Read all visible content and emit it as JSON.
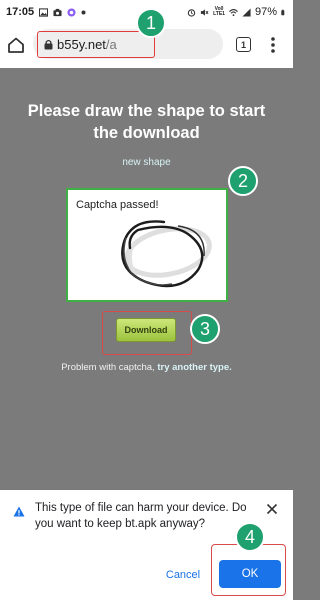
{
  "status_bar": {
    "time": "17:05",
    "network": [
      "Vo0",
      "LTE1",
      "LTE"
    ],
    "battery": "97%"
  },
  "address_bar": {
    "host": "b55y.net",
    "path": "/a",
    "tab_count": "1"
  },
  "page": {
    "title": "Please draw the shape to start the download",
    "new_shape": "new shape",
    "captcha_status": "Captcha passed!",
    "download_label": "Download",
    "problem_text": "Problem with captcha,",
    "problem_link": "try another type."
  },
  "markers": [
    "1",
    "2",
    "3",
    "4"
  ],
  "warning": {
    "message": "This type of file can harm your device. Do you want to keep bt.apk anyway?",
    "cancel_label": "Cancel",
    "ok_label": "OK"
  },
  "colors": {
    "marker": "#1fa06f",
    "highlight_border": "#d94a4a",
    "captcha_border": "#3fb043",
    "ok_button": "#1a73e8",
    "overlay_background": "#7b7b7b"
  },
  "icons": [
    "gallery-icon",
    "camera-icon",
    "app-icon",
    "home-icon",
    "lock-icon",
    "tabs-icon",
    "menu-icon",
    "warning-icon",
    "close-icon",
    "alarm-icon",
    "mute-icon",
    "wifi-icon",
    "signal-icon",
    "battery-icon"
  ]
}
